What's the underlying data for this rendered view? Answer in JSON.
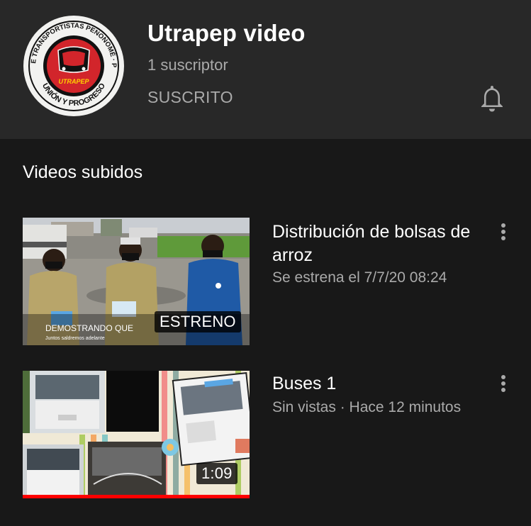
{
  "channel": {
    "name": "Utrapep video",
    "subscribers": "1 suscriptor",
    "subscribe_state": "SUSCRITO",
    "logo": {
      "ring_text_top": "UNIÓN DE TRANSPORTISTAS PENONOMÉ · PANAMÁ",
      "ring_text_bottom": "UNIÓN Y PROGRESO",
      "center_text": "UTRAPEP"
    }
  },
  "section": {
    "title": "Videos subidos"
  },
  "videos": [
    {
      "title": "Distribución de bolsas de arroz",
      "meta": "Se estrena el 7/7/20 08:24",
      "badge": "ESTRENO",
      "overlay_line1": "DEMOSTRANDO QUE",
      "overlay_line2": "Juntos saldremos adelante"
    },
    {
      "title": "Buses 1",
      "meta": "Sin vistas · Hace 12 minutos",
      "badge": "1:09",
      "watch_progress": 1.0
    }
  ],
  "colors": {
    "background": "#181818",
    "header": "#282828",
    "secondary_text": "#aaaaaa",
    "progress": "#ff0000",
    "logo_red": "#e3262b"
  },
  "icons": {
    "bell": "bell-icon",
    "menu": "more-vert-icon"
  }
}
